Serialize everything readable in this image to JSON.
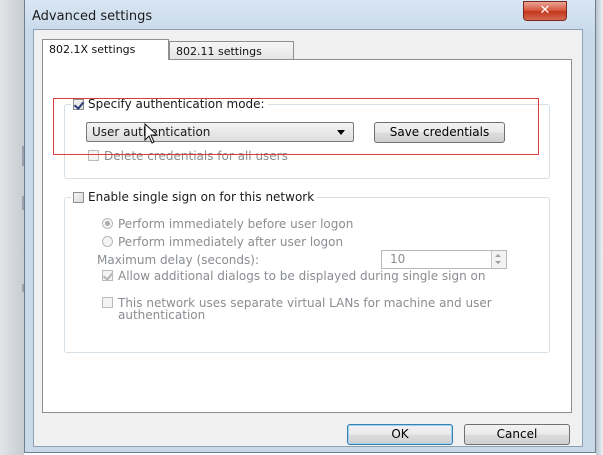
{
  "window": {
    "title": "Advanced settings",
    "close_glyph": "✕"
  },
  "tabs": [
    {
      "label": "802.1X settings",
      "active": true
    },
    {
      "label": "802.11 settings",
      "active": false
    }
  ],
  "auth_group": {
    "specify_label": "Specify authentication mode:",
    "specify_checked": true,
    "mode_value": "User authentication",
    "save_credentials_label": "Save credentials",
    "delete_label": "Delete credentials for all users",
    "delete_checked": false
  },
  "sso_group": {
    "enable_label": "Enable single sign on for this network",
    "enable_checked": false,
    "radio_before": "Perform immediately before user logon",
    "radio_after": "Perform immediately after user logon",
    "delay_label": "Maximum delay (seconds):",
    "delay_value": "10",
    "allow_dialogs_label": "Allow additional dialogs to be displayed during single sign on",
    "allow_dialogs_checked": true,
    "vlan_label": "This network uses separate virtual LANs for machine and user authentication",
    "vlan_checked": false
  },
  "footer": {
    "ok_label": "OK",
    "cancel_label": "Cancel"
  },
  "icons": {
    "close": "close-icon",
    "dropdown": "chevron-down-icon",
    "cursor": "mouse-pointer-icon",
    "spinner": "spin-updown-icon"
  },
  "colors": {
    "highlight_box": "#e03a3a",
    "close_button": "#c3361c",
    "title_bar": "#c8d9ea"
  }
}
